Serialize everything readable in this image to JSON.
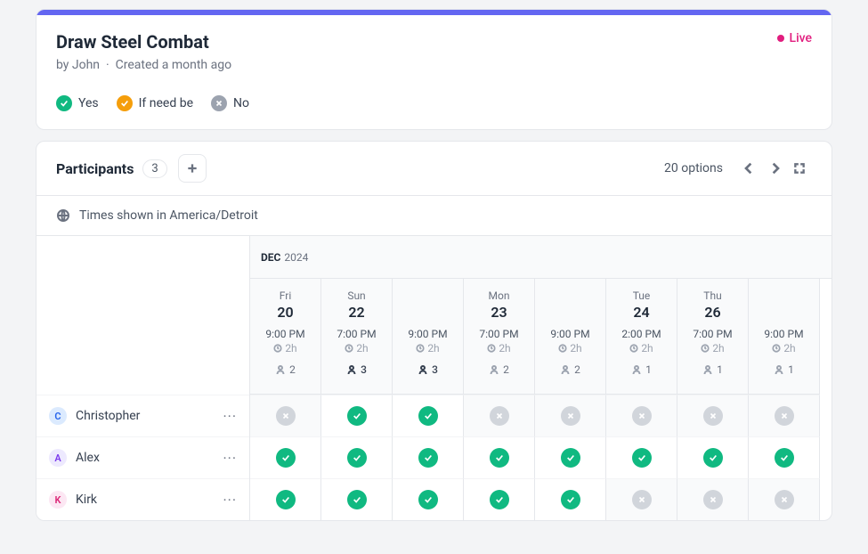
{
  "header": {
    "title": "Draw Steel Combat",
    "byline": "by John",
    "created": "Created a month ago",
    "live_label": "Live"
  },
  "legend": {
    "yes": "Yes",
    "ifneedbe": "If need be",
    "no": "No"
  },
  "participants": {
    "title": "Participants",
    "count": "3",
    "options_label": "20 options",
    "timezone_label": "Times shown in America/Detroit"
  },
  "month": {
    "label": "DEC",
    "year": "2024"
  },
  "duration": "2h",
  "days": [
    {
      "dow": "Fri",
      "dom": "20",
      "slots": [
        {
          "time": "9:00 PM",
          "count": "2",
          "full": false
        }
      ]
    },
    {
      "dow": "Sun",
      "dom": "22",
      "slots": [
        {
          "time": "7:00 PM",
          "count": "3",
          "full": true
        },
        {
          "time": "9:00 PM",
          "count": "3",
          "full": true
        }
      ]
    },
    {
      "dow": "Mon",
      "dom": "23",
      "slots": [
        {
          "time": "7:00 PM",
          "count": "2",
          "full": false
        },
        {
          "time": "9:00 PM",
          "count": "2",
          "full": false
        }
      ]
    },
    {
      "dow": "Tue",
      "dom": "24",
      "slots": [
        {
          "time": "2:00 PM",
          "count": "1",
          "full": false
        }
      ]
    },
    {
      "dow": "Thu",
      "dom": "26",
      "slots": [
        {
          "time": "7:00 PM",
          "count": "1",
          "full": false
        },
        {
          "time": "9:00 PM",
          "count": "1",
          "full": false
        }
      ]
    }
  ],
  "people": [
    {
      "initial": "C",
      "name": "Christopher",
      "avatar_bg": "#dbeafe",
      "avatar_fg": "#2563eb",
      "votes": [
        "no",
        "yes",
        "yes",
        "no",
        "no",
        "no",
        "no",
        "no"
      ]
    },
    {
      "initial": "A",
      "name": "Alex",
      "avatar_bg": "#ede9fe",
      "avatar_fg": "#7c3aed",
      "votes": [
        "yes",
        "yes",
        "yes",
        "yes",
        "yes",
        "yes",
        "yes",
        "yes"
      ]
    },
    {
      "initial": "K",
      "name": "Kirk",
      "avatar_bg": "#fce7f3",
      "avatar_fg": "#db2777",
      "votes": [
        "yes",
        "yes",
        "yes",
        "yes",
        "yes",
        "no",
        "no",
        "no"
      ]
    }
  ]
}
